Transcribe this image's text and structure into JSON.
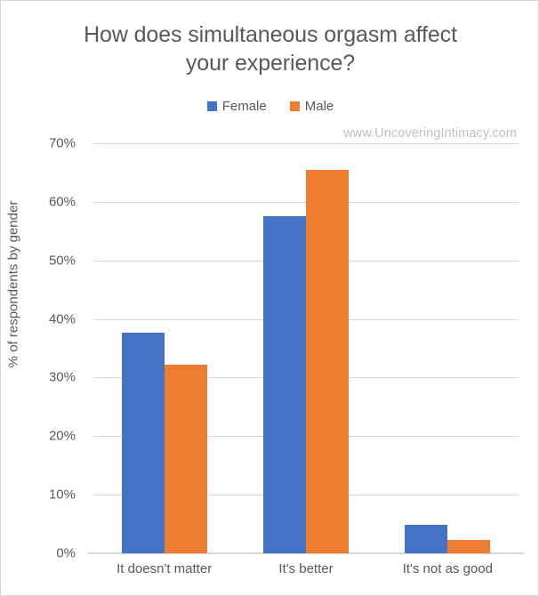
{
  "chart_data": {
    "type": "bar",
    "title": "How does simultaneous orgasm affect your experience?",
    "title_line_1": "How does simultaneous orgasm affect",
    "title_line_2": "your experience?",
    "xlabel": "",
    "ylabel": "% of respondents by gender",
    "categories": [
      "It doesn't matter",
      "It's better",
      "It's not as good"
    ],
    "series": [
      {
        "name": "Female",
        "color": "#4472C4",
        "values": [
          37.7,
          57.5,
          4.9
        ]
      },
      {
        "name": "Male",
        "color": "#ED7D31",
        "values": [
          32.2,
          65.4,
          2.3
        ]
      }
    ],
    "ylim": [
      0,
      70
    ],
    "ytick_values": [
      0,
      10,
      20,
      30,
      40,
      50,
      60,
      70
    ],
    "ytick_labels": [
      "0%",
      "10%",
      "20%",
      "30%",
      "40%",
      "50%",
      "60%",
      "70%"
    ],
    "grid": true,
    "legend_position": "top",
    "watermark": "www.UncoveringIntimacy.com",
    "plot_background": "#ffffff",
    "gridline_color": "#d9d9d9",
    "text_color": "#595959"
  }
}
